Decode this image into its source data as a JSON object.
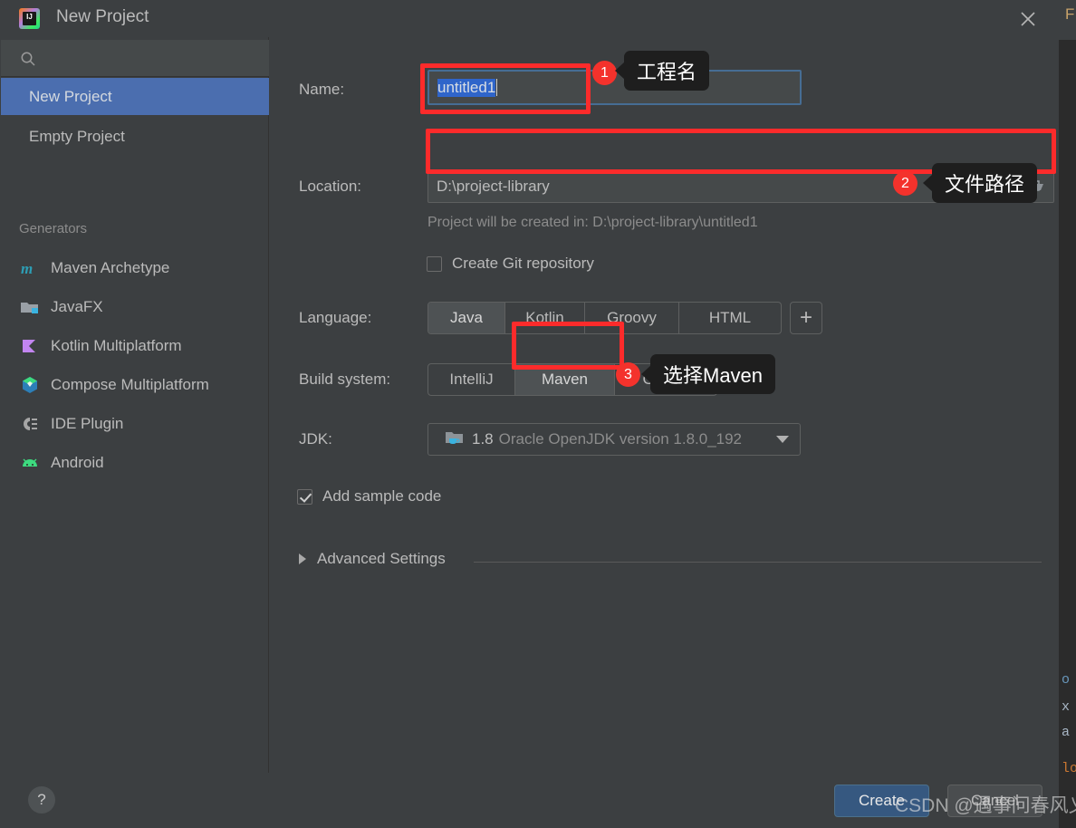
{
  "colors": {
    "dialog_bg": "#3c3f41",
    "sidebar_selected": "#4b6eaf",
    "accent_blue": "#365880",
    "annotation_red": "#f4322c",
    "focus_border": "#466d94",
    "selection_blue": "#2f65ca",
    "tooltip_bg": "#1e1e1e"
  },
  "titlebar": {
    "title": "New Project",
    "app_icon": "intellij-idea-icon",
    "close_icon": "close-icon"
  },
  "sidebar": {
    "search": {
      "value": "",
      "placeholder": "",
      "icon": "search-icon"
    },
    "items": [
      {
        "label": "New Project",
        "selected": true
      },
      {
        "label": "Empty Project",
        "selected": false
      }
    ],
    "section_label": "Generators",
    "generators": [
      {
        "label": "Maven Archetype",
        "icon": "maven-icon"
      },
      {
        "label": "JavaFX",
        "icon": "javafx-icon"
      },
      {
        "label": "Kotlin Multiplatform",
        "icon": "kotlin-icon"
      },
      {
        "label": "Compose Multiplatform",
        "icon": "compose-icon"
      },
      {
        "label": "IDE Plugin",
        "icon": "plugin-icon"
      },
      {
        "label": "Android",
        "icon": "android-icon"
      }
    ]
  },
  "form": {
    "name": {
      "label": "Name:",
      "value": "untitled1",
      "selected": true
    },
    "location": {
      "label": "Location:",
      "value": "D:\\project-library",
      "browse_icon": "folder-open-icon"
    },
    "location_hint": "Project will be created in: D:\\project-library\\untitled1",
    "git": {
      "label": "Create Git repository",
      "checked": false
    },
    "language": {
      "label": "Language:",
      "options": [
        "Java",
        "Kotlin",
        "Groovy",
        "HTML"
      ],
      "selected": "Java",
      "add_label": "+"
    },
    "build_system": {
      "label": "Build system:",
      "options": [
        "IntelliJ",
        "Maven",
        "Gradle"
      ],
      "selected": "Maven"
    },
    "jdk": {
      "label": "JDK:",
      "icon": "jdk-folder-icon",
      "version": "1.8",
      "description": "Oracle OpenJDK version 1.8.0_192",
      "arrow_icon": "chevron-down-icon"
    },
    "sample_code": {
      "label": "Add sample code",
      "checked": true
    },
    "advanced_settings": {
      "label": "Advanced Settings",
      "expanded": false,
      "chevron_icon": "chevron-right-icon"
    }
  },
  "footer": {
    "help_label": "?",
    "create_label": "Create",
    "create_mnemonic": "C",
    "cancel_label": "Cancel"
  },
  "annotations": [
    {
      "number": "1",
      "text": "工程名"
    },
    {
      "number": "2",
      "text": "文件路径"
    },
    {
      "number": "3",
      "text": "选择Maven"
    }
  ],
  "watermark": "CSDN @遇事问春风乂",
  "background_window": {
    "menu_fragment": "F",
    "code_fragments": [
      "o",
      "x",
      "a",
      "lo"
    ]
  }
}
